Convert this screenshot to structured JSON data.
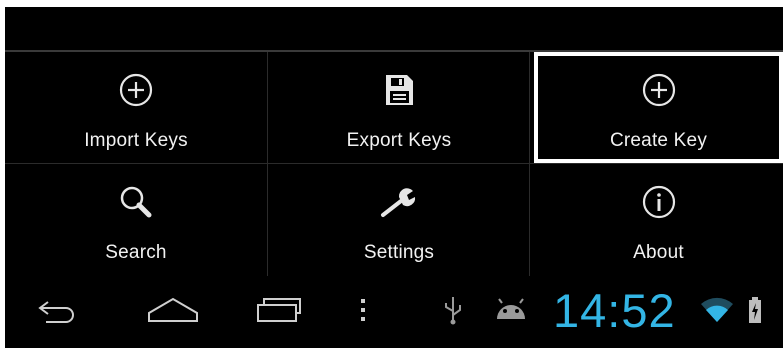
{
  "menu": {
    "items": [
      {
        "label": "Import Keys",
        "icon": "plus-circle-icon"
      },
      {
        "label": "Export Keys",
        "icon": "floppy-disk-icon"
      },
      {
        "label": "Create Key",
        "icon": "plus-circle-icon",
        "selected": true
      },
      {
        "label": "Search",
        "icon": "magnifier-icon"
      },
      {
        "label": "Settings",
        "icon": "wrench-icon"
      },
      {
        "label": "About",
        "icon": "info-circle-icon"
      }
    ]
  },
  "navbar": {
    "buttons": [
      "back-icon",
      "home-icon",
      "recent-apps-icon",
      "menu-overflow-icon"
    ]
  },
  "statusbar": {
    "time": "14:52",
    "icons": [
      "usb-icon",
      "android-debug-icon",
      "wifi-icon",
      "battery-charging-icon"
    ],
    "accent_color": "#33b5e5"
  }
}
